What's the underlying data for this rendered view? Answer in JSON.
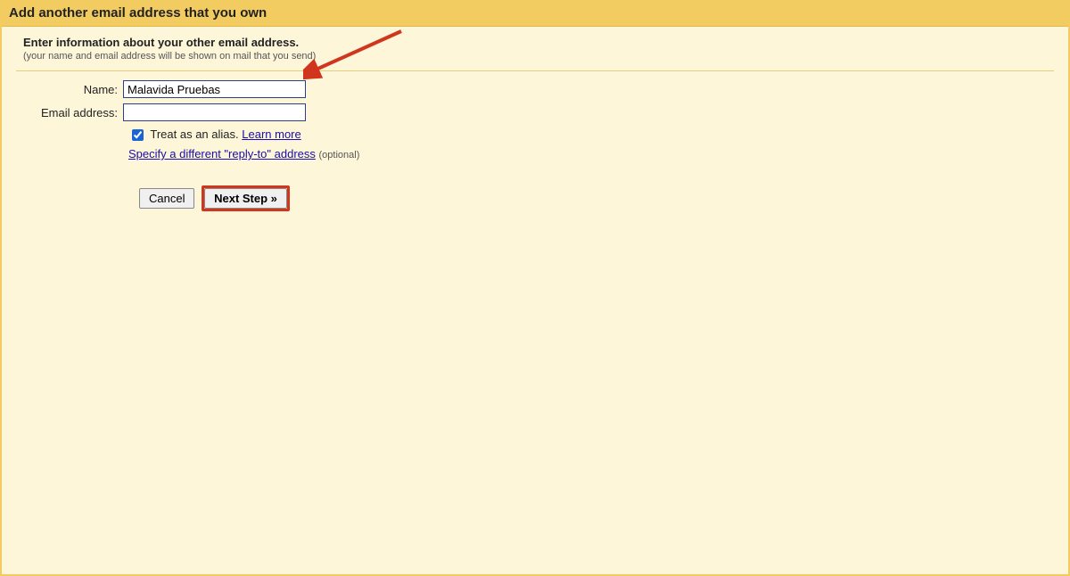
{
  "title": "Add another email address that you own",
  "instructions": {
    "line1": "Enter information about your other email address.",
    "line2": "(your name and email address will be shown on mail that you send)"
  },
  "form": {
    "name_label": "Name:",
    "name_value": "Malavida Pruebas",
    "email_label": "Email address:",
    "email_value": ""
  },
  "options": {
    "alias_checked": true,
    "alias_text": "Treat as an alias.",
    "learn_more": "Learn more",
    "reply_to_link": "Specify a different \"reply-to\" address",
    "optional": "(optional)"
  },
  "buttons": {
    "cancel": "Cancel",
    "next": "Next Step »"
  }
}
